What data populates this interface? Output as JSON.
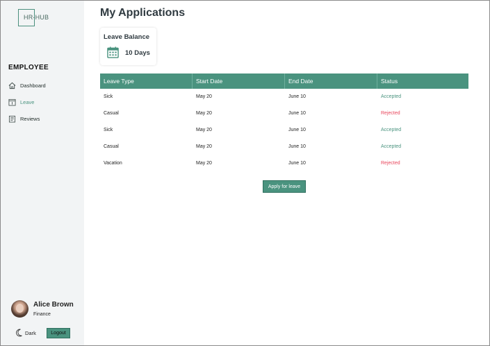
{
  "sidebar": {
    "logo_text": "HR-HUB",
    "section_title": "EMPLOYEE",
    "items": [
      {
        "label": "Dashboard",
        "icon": "home-icon",
        "active": false
      },
      {
        "label": "Leave",
        "icon": "calendar-icon",
        "active": true
      },
      {
        "label": "Reviews",
        "icon": "clipboard-icon",
        "active": false
      }
    ],
    "profile": {
      "name": "Alice Brown",
      "department": "Finance"
    },
    "theme_label": "Dark",
    "logout_label": "Logout"
  },
  "main": {
    "title": "My Applications",
    "balance": {
      "title": "Leave Balance",
      "value": "10 Days",
      "icon": "calendar-icon"
    },
    "table": {
      "headers": [
        "Leave Type",
        "Start Date",
        "End Date",
        "Status"
      ],
      "rows": [
        {
          "type": "Sick",
          "start": "May 20",
          "end": "June 10",
          "status": "Accepted"
        },
        {
          "type": "Casual",
          "start": "May 20",
          "end": "June 10",
          "status": "Rejected"
        },
        {
          "type": "Sick",
          "start": "May 20",
          "end": "June 10",
          "status": "Accepted"
        },
        {
          "type": "Casual",
          "start": "May 20",
          "end": "June 10",
          "status": "Accepted"
        },
        {
          "type": "Vacation",
          "start": "May 20",
          "end": "June 10",
          "status": "Rejected"
        }
      ]
    },
    "apply_label": "Apply for leave"
  },
  "colors": {
    "accent": "#4a937f",
    "accepted": "#4a937f",
    "rejected": "#e8465c",
    "sidebar_bg": "#f2f4f5"
  }
}
